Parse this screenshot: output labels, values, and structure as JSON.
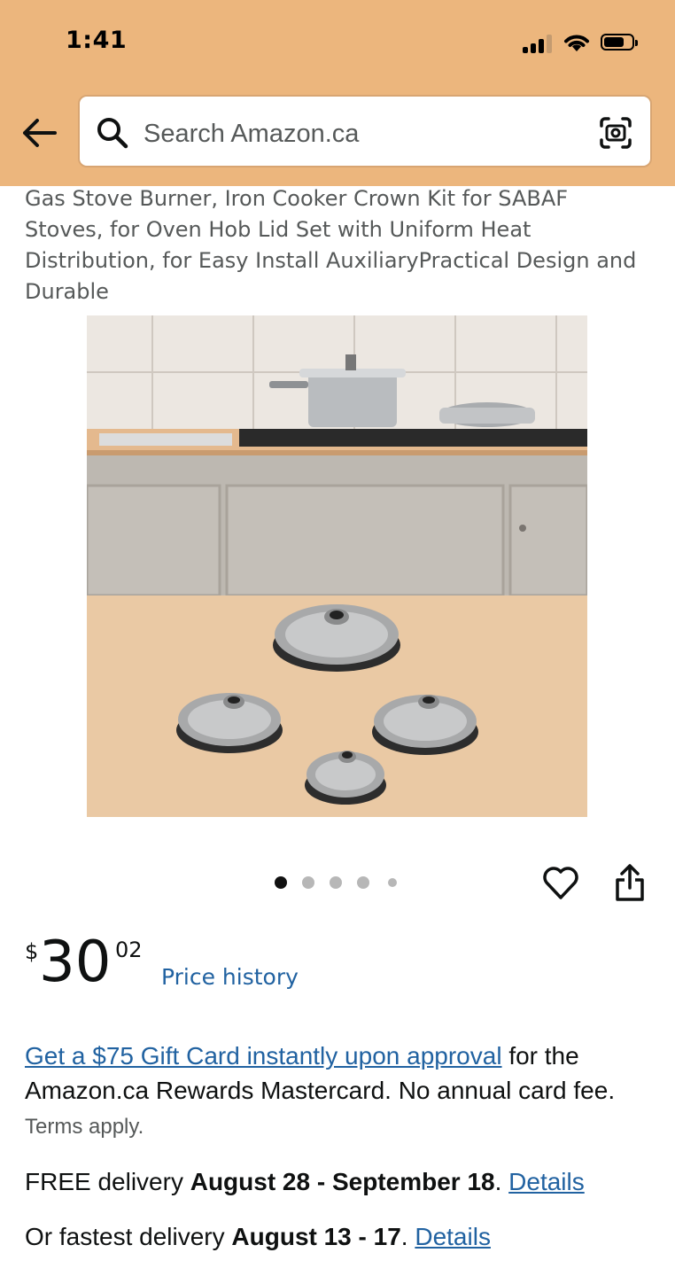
{
  "status_bar": {
    "time": "1:41"
  },
  "search": {
    "placeholder": "Search Amazon.ca"
  },
  "product": {
    "title": "Gas Stove Burner, Iron Cooker Crown Kit for SABAF Stoves, for Oven Hob Lid Set with Uniform Heat Distribution, for Easy Install AuxiliaryPractical Design and Durable",
    "image_count": 5,
    "active_image": 1
  },
  "price": {
    "symbol": "$",
    "whole": "30",
    "fraction": "02",
    "history_label": "Price history"
  },
  "promo": {
    "link_text": "Get a $75 Gift Card instantly upon approval",
    "text": " for the Amazon.ca Rewards Mastercard. No annual card fee. ",
    "terms": "Terms apply."
  },
  "delivery": {
    "free_prefix": "FREE delivery ",
    "free_dates": "August 28 - September 18",
    "free_suffix": ". ",
    "free_link": "Details",
    "fast_prefix": "Or fastest delivery ",
    "fast_dates": "August 13 - 17",
    "fast_suffix": ". ",
    "fast_link": "Details"
  },
  "colors": {
    "header_bg": "#ecb67d",
    "link": "#2162a1",
    "secondary_text": "#565959"
  },
  "icons": [
    "back-arrow-icon",
    "search-icon",
    "camera-icon",
    "heart-icon",
    "share-icon",
    "wifi-icon",
    "battery-icon",
    "signal-icon"
  ]
}
